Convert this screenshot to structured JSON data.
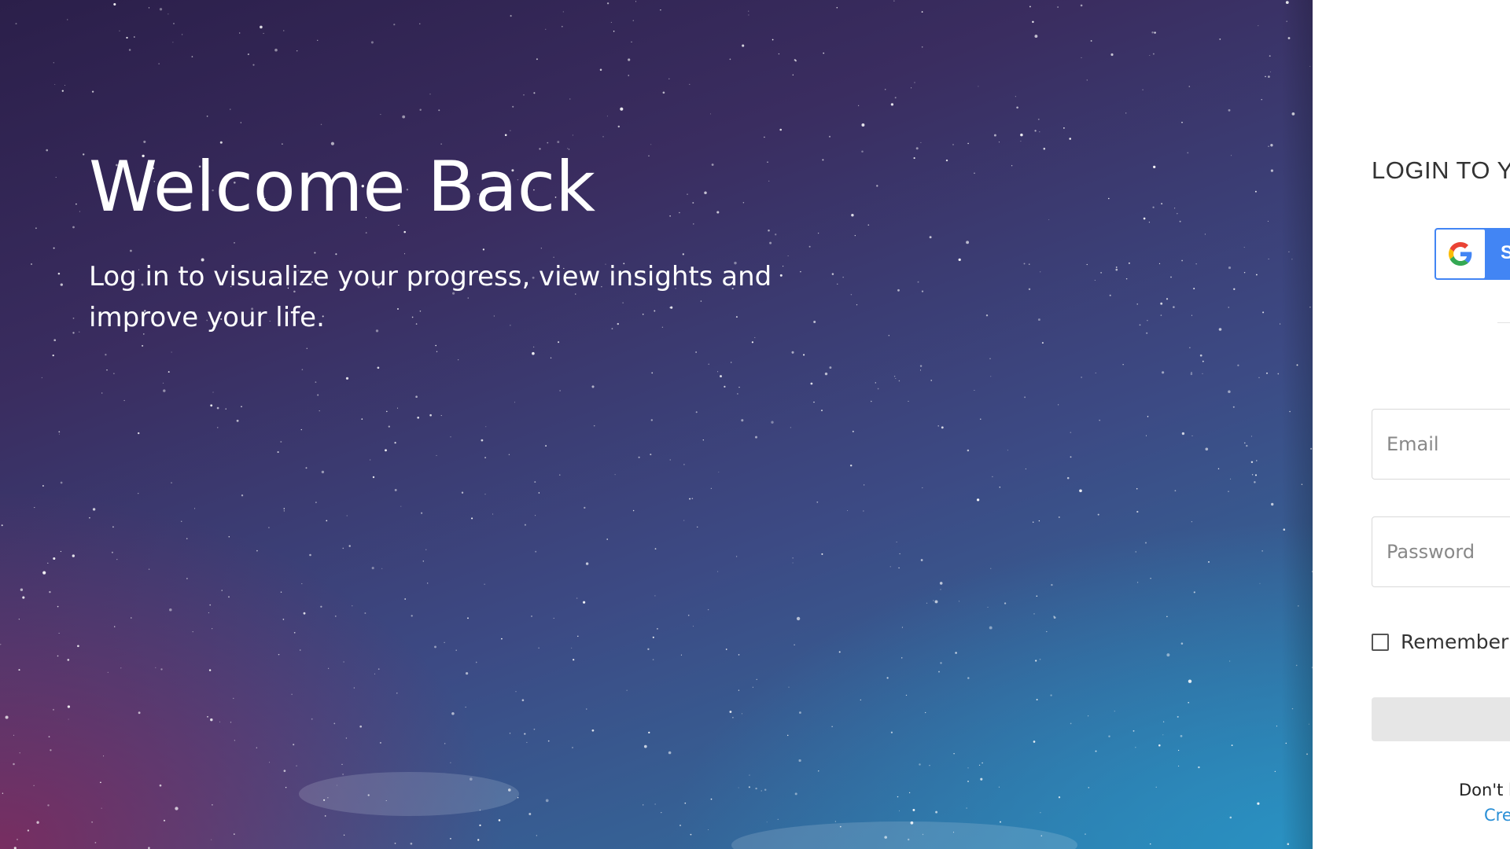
{
  "hero": {
    "title": "Welcome Back",
    "subtitle": "Log in to visualize your progress, view insights and improve your life."
  },
  "login": {
    "heading": "LOGIN TO YOUR ACCOUNT",
    "google_button": {
      "label": "Sign in with Google",
      "icon": "google-g-icon"
    },
    "email": {
      "placeholder": "Email",
      "value": ""
    },
    "password": {
      "placeholder": "Password",
      "value": ""
    },
    "remember_me": {
      "label": "Remember Me",
      "checked": false
    },
    "submit_label": "",
    "signup_prompt": "Don't have an account?",
    "signup_link": "Create Account"
  },
  "colors": {
    "google_blue": "#4285f4",
    "link_blue": "#2a8fd6",
    "button_disabled": "#e6e6e6"
  }
}
